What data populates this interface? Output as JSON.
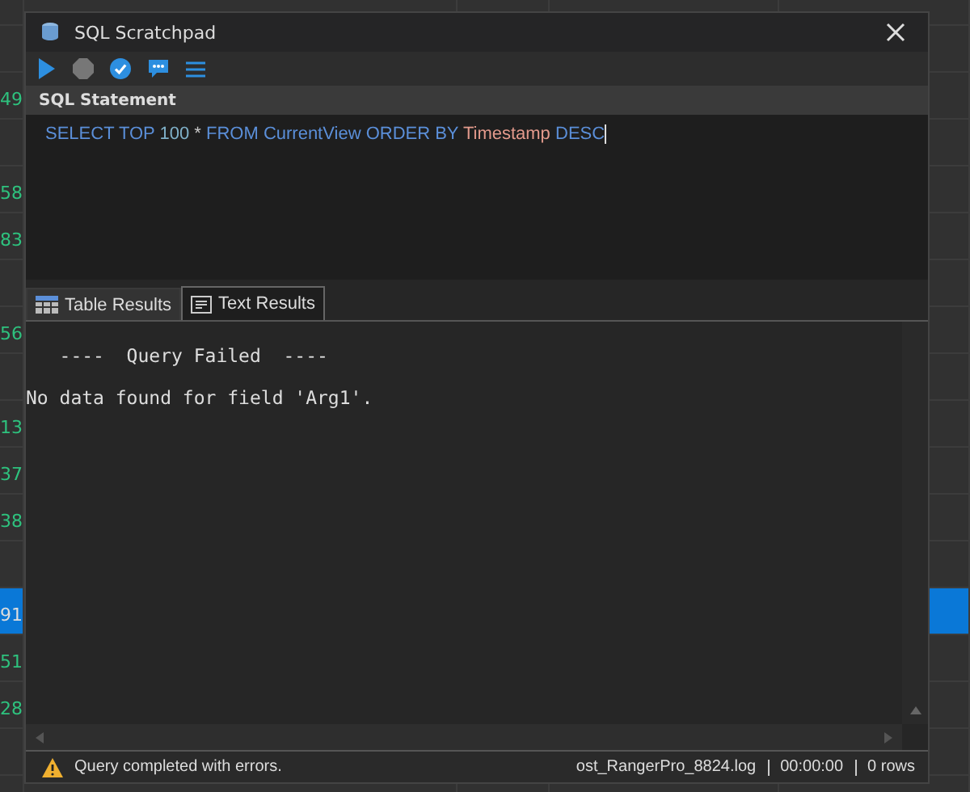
{
  "background_grid": {
    "rows": [
      {
        "selected": false
      },
      {
        "selected": false
      },
      {
        "number": "49",
        "selected": false
      },
      {
        "selected": false
      },
      {
        "number": "58",
        "selected": false
      },
      {
        "number": "83",
        "selected": false
      },
      {
        "selected": false
      },
      {
        "number": "56",
        "selected": false
      },
      {
        "selected": false
      },
      {
        "number": "13",
        "selected": false
      },
      {
        "number": "37",
        "selected": false
      },
      {
        "number": "38",
        "selected": false
      },
      {
        "selected": false
      },
      {
        "number": "91",
        "selected": true
      },
      {
        "number": "51",
        "selected": false
      },
      {
        "number": "28",
        "selected": false
      },
      {
        "selected": false
      },
      {
        "selected": false
      }
    ]
  },
  "window": {
    "title": "SQL Scratchpad"
  },
  "section_header": "SQL Statement",
  "sql_tokens": [
    {
      "text": "SELECT TOP",
      "kind": "keyword"
    },
    {
      "text": "100",
      "kind": "number"
    },
    {
      "text": "*",
      "kind": "operator"
    },
    {
      "text": "FROM CurrentView ORDER BY",
      "kind": "keyword"
    },
    {
      "text": "Timestamp",
      "kind": "identifier"
    },
    {
      "text": "DESC",
      "kind": "keyword"
    }
  ],
  "tabs": [
    {
      "label": "Table Results",
      "selected": false,
      "kind": "table"
    },
    {
      "label": "Text Results",
      "selected": true,
      "kind": "text"
    }
  ],
  "output_lines": [
    "   ----  Query Failed  ----",
    "No data found for field 'Arg1'."
  ],
  "status_bar": {
    "message": "Query completed with errors.",
    "log_file": "ost_RangerPro_8824.log",
    "elapsed": "00:00:00",
    "rows": "0 rows"
  }
}
